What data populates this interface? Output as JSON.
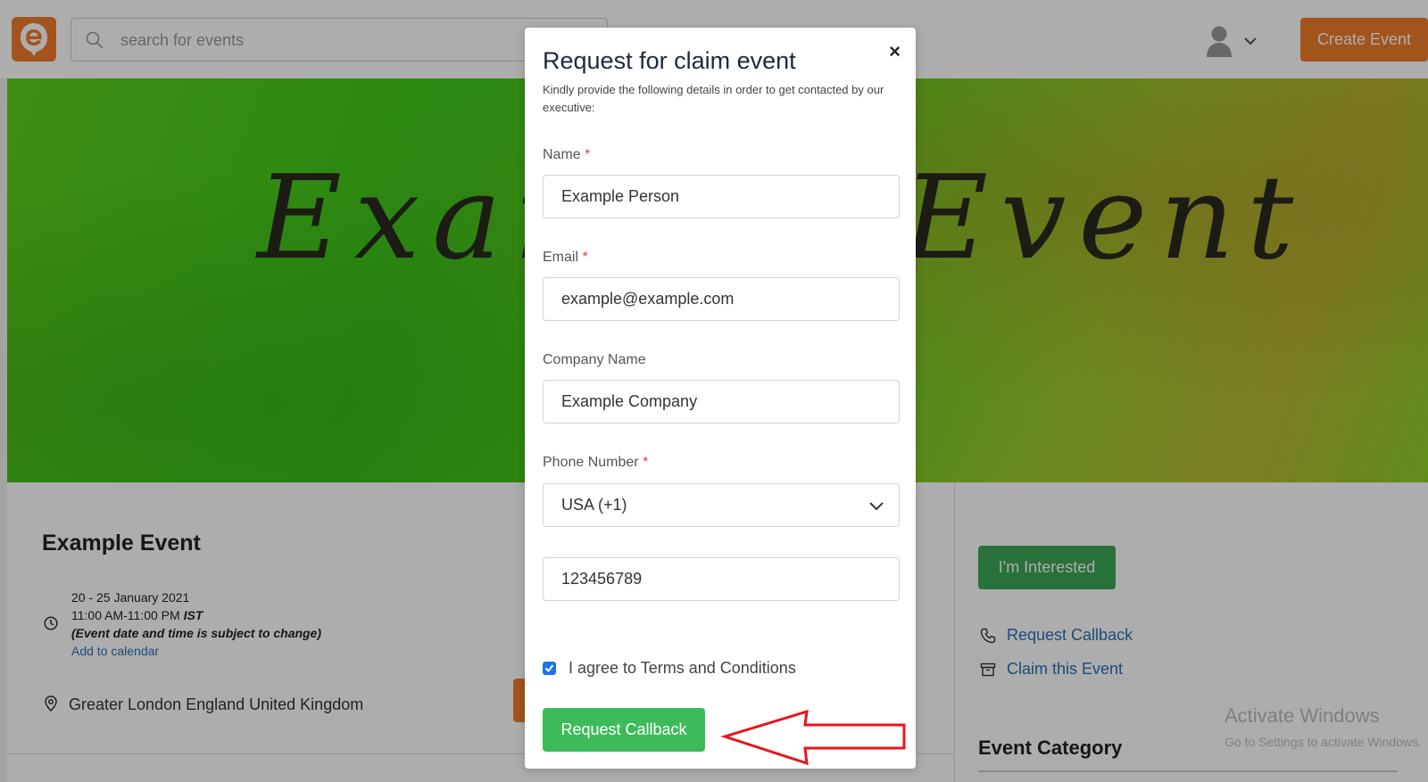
{
  "header": {
    "search_placeholder": "search for events",
    "create_event_label": "Create Event"
  },
  "banner": {
    "text": "Example Event"
  },
  "event": {
    "title": "Example Event",
    "date": "20 - 25 January 2021",
    "time": "11:00 AM-11:00 PM",
    "timezone": "IST",
    "note": "(Event date and time is subject to change)",
    "add_to_calendar": "Add to calendar",
    "location": "Greater London England United Kingdom"
  },
  "sidebar": {
    "interested_label": "I'm Interested",
    "request_callback_label": "Request Callback",
    "claim_event_label": "Claim this Event",
    "category_title": "Event Category"
  },
  "watermark": {
    "title": "Activate Windows",
    "subtitle": "Go to Settings to activate Windows."
  },
  "modal": {
    "close": "×",
    "title": "Request for claim event",
    "subtitle": "Kindly provide the following details in order to get contacted by our executive:",
    "name_label": "Name",
    "name_value": "Example Person",
    "email_label": "Email",
    "email_value": "example@example.com",
    "company_label": "Company Name",
    "company_value": "Example Company",
    "phone_label": "Phone Number",
    "country_code": "USA (+1)",
    "phone_value": "123456789",
    "required_mark": "*",
    "agree_label": "I agree to Terms and Conditions",
    "agree_checked": true,
    "submit_label": "Request Callback"
  },
  "colors": {
    "brand": "#f07c2c",
    "success": "#3dbb5a",
    "link": "#2a6fb5",
    "annotation_arrow": "#e8141c"
  }
}
